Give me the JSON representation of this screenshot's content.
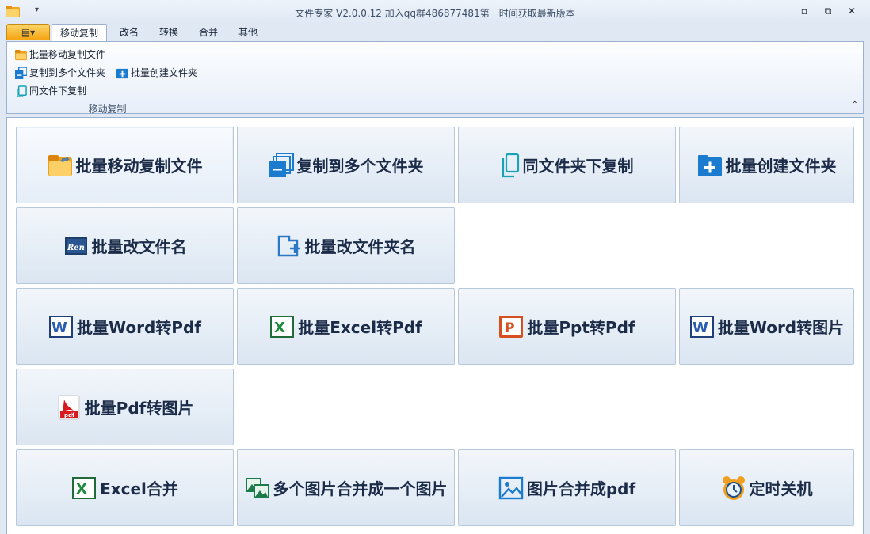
{
  "window": {
    "title": "文件专家 V2.0.0.12 加入qq群486877481第一时间获取最新版本",
    "minimize": "▫",
    "restore": "⧉",
    "close": "✕",
    "quick_access": "▾"
  },
  "tabs": {
    "file_menu": "▤▾",
    "items": [
      {
        "label": "移动复制",
        "active": true
      },
      {
        "label": "改名"
      },
      {
        "label": "转换"
      },
      {
        "label": "合并"
      },
      {
        "label": "其他"
      }
    ]
  },
  "ribbon": {
    "group_label": "移动复制",
    "items": [
      {
        "label": "批量移动复制文件",
        "icon": "folder-icon"
      },
      {
        "label": "复制到多个文件夹",
        "icon": "copy-multi-icon"
      },
      {
        "label": "批量创建文件夹",
        "icon": "add-folder-icon"
      },
      {
        "label": "同文件下复制",
        "icon": "duplicate-icon"
      }
    ],
    "collapse": "⌃"
  },
  "cards": [
    {
      "label": "批量移动复制文件",
      "icon": "folder-icon"
    },
    {
      "label": "复制到多个文件夹",
      "icon": "copy-multi-icon"
    },
    {
      "label": "同文件夹下复制",
      "icon": "duplicate-icon"
    },
    {
      "label": "批量创建文件夹",
      "icon": "add-folder-icon"
    },
    {
      "label": "批量改文件名",
      "icon": "rename-icon"
    },
    {
      "label": "批量改文件夹名",
      "icon": "rename-folder-icon"
    },
    {
      "label": "批量Word转Pdf",
      "icon": "word-icon"
    },
    {
      "label": "批量Excel转Pdf",
      "icon": "excel-icon"
    },
    {
      "label": "批量Ppt转Pdf",
      "icon": "ppt-icon"
    },
    {
      "label": "批量Word转图片",
      "icon": "word-icon"
    },
    {
      "label": "批量Pdf转图片",
      "icon": "pdf-icon"
    },
    {
      "label": "Excel合并",
      "icon": "excel-icon"
    },
    {
      "label": "多个图片合并成一个图片",
      "icon": "image-merge-icon"
    },
    {
      "label": "图片合并成pdf",
      "icon": "image-icon"
    },
    {
      "label": "定时关机",
      "icon": "alarm-clock-icon"
    }
  ],
  "icon_text": {
    "ren": "Ren",
    "pdf": "pdf"
  },
  "colors": {
    "accent": "#f5a10e",
    "border": "#9ab2cf",
    "text": "#1b2b48"
  }
}
